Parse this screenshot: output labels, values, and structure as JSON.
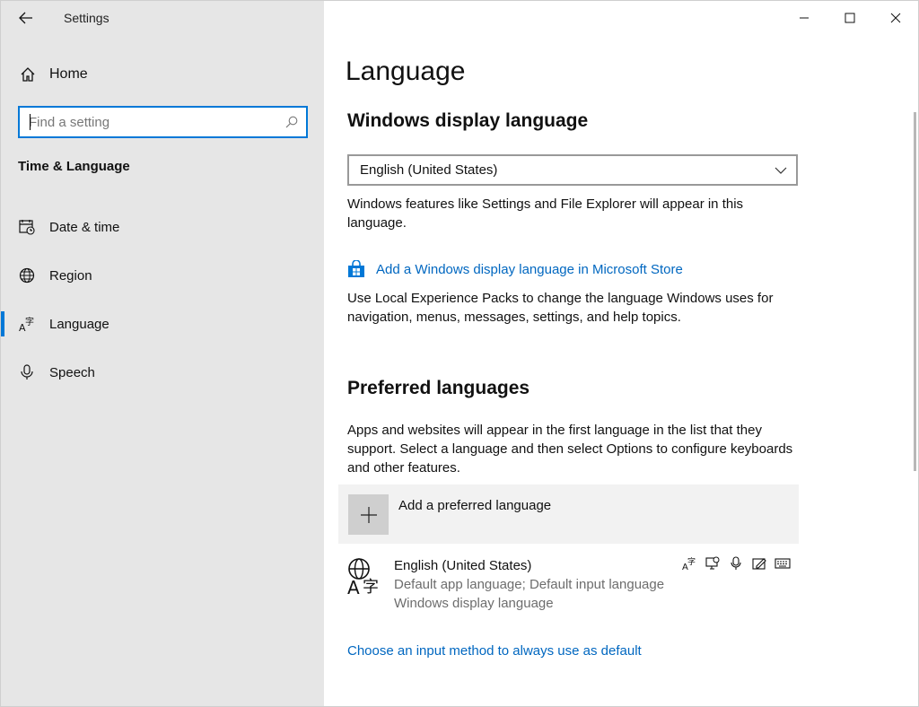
{
  "window": {
    "app_title": "Settings"
  },
  "sidebar": {
    "home_label": "Home",
    "search": {
      "placeholder": "Find a setting",
      "value": ""
    },
    "section_title": "Time & Language",
    "items": [
      {
        "label": "Date & time",
        "icon": "calendar-clock-icon"
      },
      {
        "label": "Region",
        "icon": "globe-icon"
      },
      {
        "label": "Language",
        "icon": "language-icon",
        "active": true
      },
      {
        "label": "Speech",
        "icon": "microphone-icon"
      }
    ]
  },
  "main": {
    "title": "Language",
    "display_language": {
      "heading": "Windows display language",
      "selected": "English (United States)",
      "description": "Windows features like Settings and File Explorer will appear in this language.",
      "store_link": "Add a Windows display language in Microsoft Store",
      "lxp_text": "Use Local Experience Packs to change the language Windows uses for navigation, menus, messages, settings, and help topics."
    },
    "preferred": {
      "heading": "Preferred languages",
      "description": "Apps and websites will appear in the first language in the list that they support. Select a language and then select Options to configure keyboards and other features.",
      "add_label": "Add a preferred language",
      "languages": [
        {
          "name": "English (United States)",
          "meta1": "Default app language; Default input language",
          "meta2": "Windows display language",
          "features": [
            "language-pack-icon",
            "display-icon",
            "microphone-icon",
            "handwriting-icon",
            "keyboard-icon"
          ]
        }
      ]
    },
    "input_method_link": "Choose an input method to always use as default"
  },
  "colors": {
    "accent": "#0078d7",
    "link": "#0067c0",
    "sidebar_bg": "#e6e6e6"
  }
}
